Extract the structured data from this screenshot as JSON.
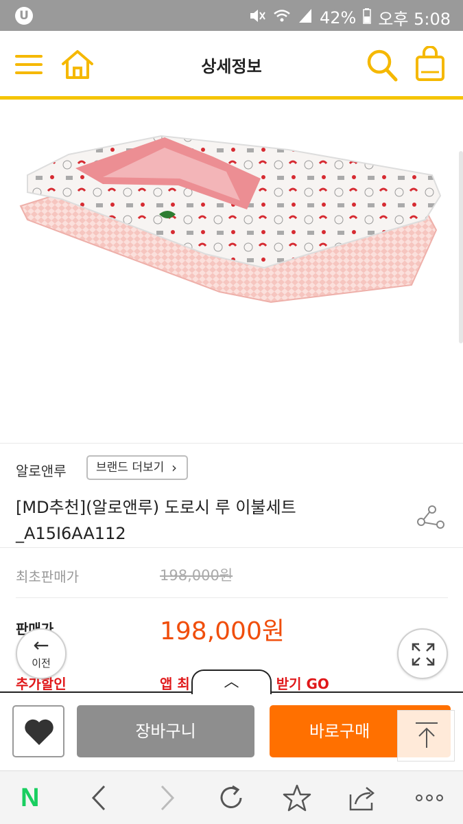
{
  "status_bar": {
    "carrier_logo": "U",
    "battery": "42%",
    "time": "오후 5:08",
    "icons": [
      "mute-icon",
      "wifi-icon",
      "signal-icon",
      "battery-icon"
    ]
  },
  "header": {
    "title": "상세정보",
    "accent_color": "#f5c400",
    "icons": [
      "menu-icon",
      "home-icon",
      "search-icon",
      "shopping-bag-icon"
    ]
  },
  "product": {
    "brand": "알로앤루",
    "brand_more_label": "브랜드 더보기",
    "title_line1": "[MD추천](알로앤루) 도로시 루 이불세트",
    "title_line2": "_A15I6AA112",
    "original_price_label": "최초판매가",
    "original_price": "198,000원",
    "sale_price_label": "판매가",
    "sale_price": "198,000원",
    "extra_discount_label": "추가할인",
    "extra_discount_text": "앱 최",
    "extra_discount_text2": "받기 GO",
    "sale_color": "#f04e0c"
  },
  "floating": {
    "back_label": "이전"
  },
  "purchase_bar": {
    "cart_label": "장바구니",
    "buy_label": "바로구매",
    "buy_color": "#ff7000",
    "cart_color": "#8e8e8e"
  },
  "browser_nav": {
    "logo": "N",
    "icons": [
      "back-icon",
      "forward-icon",
      "refresh-icon",
      "bookmark-star-icon",
      "share-icon",
      "more-icon"
    ]
  }
}
